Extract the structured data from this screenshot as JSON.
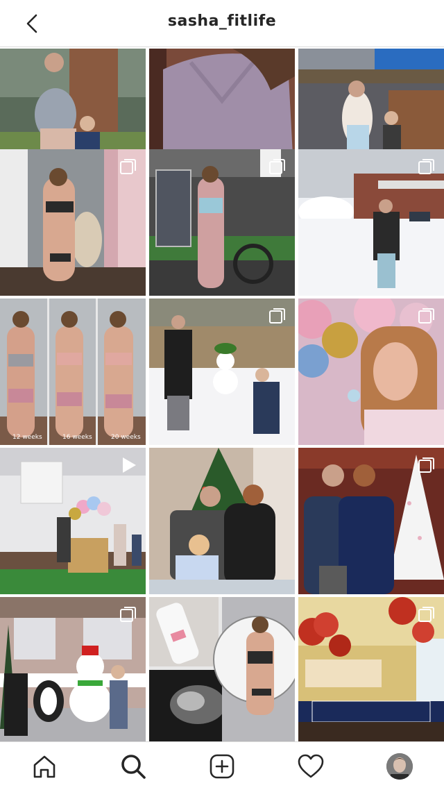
{
  "header": {
    "title": "sasha_fitlife",
    "back_icon": "chevron-left-icon"
  },
  "grid": {
    "posts": [
      {
        "id": "post-1",
        "kind": "image"
      },
      {
        "id": "post-2",
        "kind": "image"
      },
      {
        "id": "post-3",
        "kind": "image"
      },
      {
        "id": "post-4",
        "kind": "carousel"
      },
      {
        "id": "post-5",
        "kind": "carousel"
      },
      {
        "id": "post-6",
        "kind": "carousel"
      },
      {
        "id": "post-7",
        "kind": "image",
        "captions": [
          "12 weeks",
          "16 weeks",
          "20 weeks"
        ]
      },
      {
        "id": "post-8",
        "kind": "carousel"
      },
      {
        "id": "post-9",
        "kind": "carousel"
      },
      {
        "id": "post-10",
        "kind": "video"
      },
      {
        "id": "post-11",
        "kind": "image"
      },
      {
        "id": "post-12",
        "kind": "carousel"
      },
      {
        "id": "post-13",
        "kind": "carousel"
      },
      {
        "id": "post-14",
        "kind": "image"
      },
      {
        "id": "post-15",
        "kind": "carousel"
      }
    ]
  },
  "bottom_nav": {
    "items": [
      {
        "name": "home",
        "icon": "home-icon"
      },
      {
        "name": "search",
        "icon": "search-icon",
        "active": true
      },
      {
        "name": "new-post",
        "icon": "plus-square-icon"
      },
      {
        "name": "activity",
        "icon": "heart-icon"
      },
      {
        "name": "profile",
        "icon": "avatar"
      }
    ]
  },
  "colors": {
    "text": "#262626",
    "border": "#dbdbdb",
    "background": "#ffffff"
  }
}
